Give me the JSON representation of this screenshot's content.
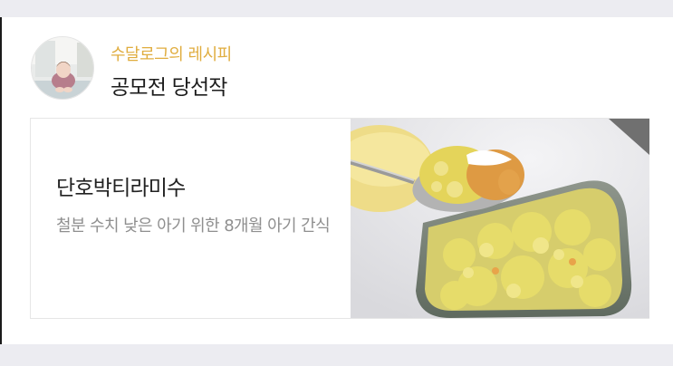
{
  "recipe_card": {
    "author": "수달로그의 레시피",
    "title": "공모전 당선작",
    "recipe_name": "단호박티라미수",
    "description": "철분 수치 낮은 아기 위한 8개월 아기 간식",
    "photo_subject": "pumpkin tiramisu in glass container with spoon",
    "avatar_subject": "baby sitting"
  },
  "colors": {
    "author_accent": "#e0ad3f",
    "title_text": "#1c1c1c",
    "description_text": "#8f8f8f",
    "background_band": "#ececf1"
  }
}
